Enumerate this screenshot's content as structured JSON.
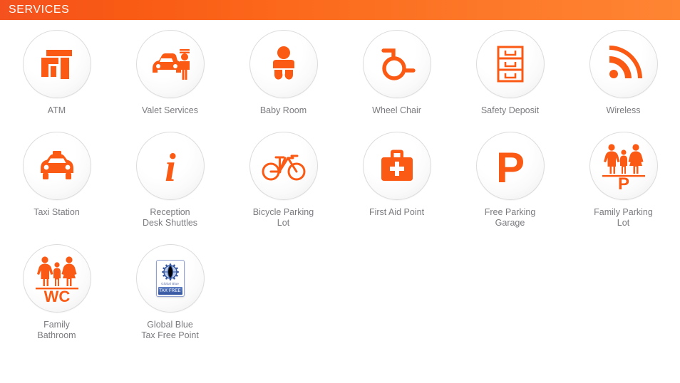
{
  "header": {
    "title": "SERVICES",
    "gradient_start": "#f4511e",
    "gradient_end": "#ff8533",
    "text_color": "#ffffff"
  },
  "theme": {
    "accent": "#f4511e",
    "icon_color": "#fa5a14",
    "label_color": "#7b7b80",
    "badge_border": "#dcdcdc",
    "background": "#ffffff"
  },
  "services": [
    {
      "id": "atm",
      "label": "ATM",
      "icon": "atm-icon"
    },
    {
      "id": "valet-services",
      "label": "Valet Services",
      "icon": "valet-car-attendant-icon"
    },
    {
      "id": "baby-room",
      "label": "Baby Room",
      "icon": "baby-icon"
    },
    {
      "id": "wheel-chair",
      "label": "Wheel Chair",
      "icon": "wheelchair-icon"
    },
    {
      "id": "safety-deposit",
      "label": "Safety Deposit",
      "icon": "safety-deposit-boxes-icon"
    },
    {
      "id": "wireless",
      "label": "Wireless",
      "icon": "wireless-signal-icon"
    },
    {
      "id": "taxi-station",
      "label": "Taxi Station",
      "icon": "taxi-icon"
    },
    {
      "id": "reception-desk-shuttles",
      "label": "Reception\nDesk Shuttles",
      "icon": "information-i-icon"
    },
    {
      "id": "bicycle-parking-lot",
      "label": "Bicycle Parking\nLot",
      "icon": "bicycle-icon"
    },
    {
      "id": "first-aid-point",
      "label": "First Aid Point",
      "icon": "first-aid-kit-icon"
    },
    {
      "id": "free-parking-garage",
      "label": "Free Parking\nGarage",
      "icon": "parking-p-icon"
    },
    {
      "id": "family-parking-lot",
      "label": "Family Parking\nLot",
      "icon": "family-parking-icon"
    },
    {
      "id": "family-bathroom",
      "label": "Family\nBathroom",
      "icon": "family-wc-icon"
    },
    {
      "id": "global-blue-tax-free-point",
      "label": "Global Blue\nTax Free Point",
      "icon": "global-blue-tax-free-card-icon"
    }
  ],
  "global_blue_card": {
    "brand": "Global Blue",
    "banner": "TAX FREE"
  },
  "glyphs": {
    "parking_letter": "P",
    "family_parking_letter": "P",
    "wc_letters": "WC",
    "info_letter": "i"
  }
}
